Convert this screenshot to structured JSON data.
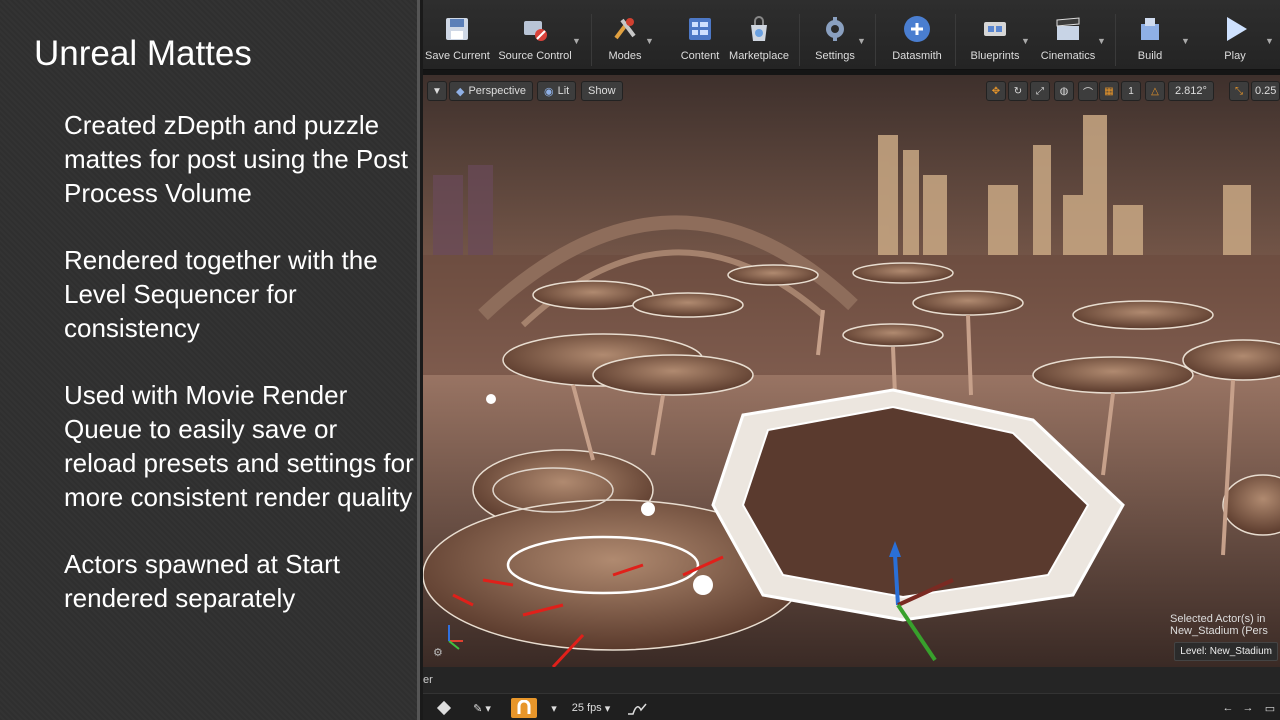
{
  "slide": {
    "title": "Unreal Mattes",
    "bullets": [
      "Created zDepth and puzzle mattes for post using the Post Process Volume",
      "Rendered together with the Level Sequencer for consistency",
      "Used with Movie Render Queue to easily save or reload presets and settings for more consistent render quality",
      "Actors spawned at Start rendered separately"
    ]
  },
  "toolbar": {
    "buttons": [
      {
        "label": "Save Current",
        "icon": "save-icon"
      },
      {
        "label": "Source Control",
        "icon": "source-control-icon"
      },
      {
        "label": "Modes",
        "icon": "modes-icon"
      },
      {
        "label": "Content",
        "icon": "content-icon"
      },
      {
        "label": "Marketplace",
        "icon": "marketplace-icon"
      },
      {
        "label": "Settings",
        "icon": "settings-icon"
      },
      {
        "label": "Datasmith",
        "icon": "datasmith-icon"
      },
      {
        "label": "Blueprints",
        "icon": "blueprints-icon"
      },
      {
        "label": "Cinematics",
        "icon": "cinematics-icon"
      },
      {
        "label": "Build",
        "icon": "build-icon"
      },
      {
        "label": "Play",
        "icon": "play-icon"
      }
    ]
  },
  "viewport": {
    "perspective_label": "Perspective",
    "lit_label": "Lit",
    "show_label": "Show",
    "grid_value": "1",
    "angle_value": "2.812°",
    "scale_value": "0.25",
    "selected_actors": "Selected Actor(s) in",
    "selected_name": "New_Stadium (Pers",
    "level_label": "Level:",
    "level_name": "New_Stadium"
  },
  "bottom": {
    "strip_text": "er",
    "fps": "25 fps"
  },
  "colors": {
    "slide_bg": "#333333",
    "toolbar_bg": "#2a2a2a",
    "accent_orange": "#e8962a"
  }
}
